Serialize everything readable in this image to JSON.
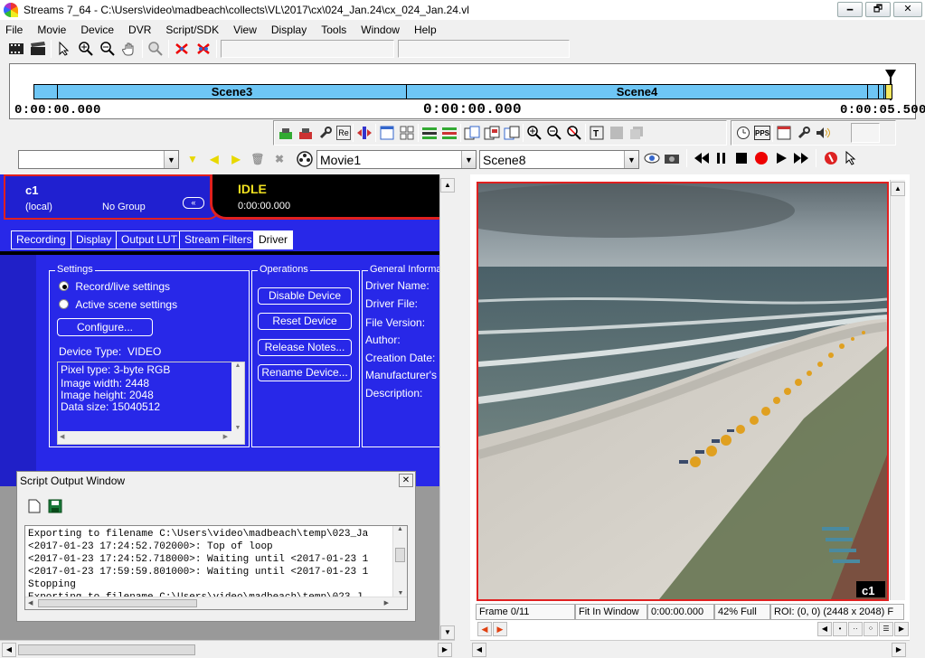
{
  "window": {
    "title": "Streams 7_64 - C:\\Users\\video\\madbeach\\collects\\VL\\2017\\cx\\024_Jan.24\\cx_024_Jan.24.vl",
    "minimize": "🗕",
    "maximize": "🗗",
    "close": "✕"
  },
  "menu": [
    "File",
    "Movie",
    "Device",
    "DVR",
    "Script/SDK",
    "View",
    "Display",
    "Tools",
    "Window",
    "Help"
  ],
  "timeline": {
    "scenes": [
      "Scene3",
      "Scene4"
    ],
    "start_time": "0:00:00.000",
    "current_time": "0:00:00.000",
    "end_time": "0:00:05.500"
  },
  "toolbar2": {
    "re_label": "Re",
    "pps_label": "PPS"
  },
  "selectors": {
    "device_select": "",
    "movie_select": "Movie1",
    "scene_select": "Scene8"
  },
  "device": {
    "name": "c1",
    "location": "(local)",
    "group": "No Group",
    "status": "IDLE",
    "time": "0:00:00.000"
  },
  "tabs": [
    "Recording",
    "Display",
    "Output LUT",
    "Stream Filters",
    "Driver"
  ],
  "settings": {
    "legend": "Settings",
    "radio_record": "Record/live settings",
    "radio_active": "Active scene settings",
    "configure_button": "Configure...",
    "device_type_label": "Device Type:",
    "device_type_value": "VIDEO",
    "info_lines": [
      "Pixel type: 3-byte RGB",
      "Image width: 2448",
      "Image height: 2048",
      "Data size: 15040512"
    ]
  },
  "operations": {
    "legend": "Operations",
    "buttons": [
      "Disable Device",
      "Reset Device",
      "Release Notes...",
      "Rename Device..."
    ]
  },
  "general_info": {
    "legend": "General Informati",
    "labels": [
      "Driver Name:",
      "Driver File:",
      "File Version:",
      "Author:",
      "Creation Date:",
      "Manufacturer's Li",
      "Description:"
    ]
  },
  "script_window": {
    "title": "Script Output Window",
    "close": "✕",
    "lines": [
      "Exporting to filename C:\\Users\\video\\madbeach\\temp\\023_Ja",
      "<2017-01-23 17:24:52.702000>: Top of loop",
      "<2017-01-23 17:24:52.718000>: Waiting until <2017-01-23 1",
      "<2017-01-23 17:59:59.801000>: Waiting until <2017-01-23 1",
      "Stopping",
      "Exporting to filename C:\\Users\\video\\madbeach\\temp\\023_J"
    ]
  },
  "viewer": {
    "overlay_label": "c1",
    "frame": "Frame 0/11",
    "fit": "Fit In Window",
    "time": "0:00:00.000",
    "zoom": "42% Full",
    "roi": "ROI: (0, 0) (2448 x 2048) F"
  },
  "colors": {
    "panel_blue": "#2828e8",
    "accent_red": "#e02020",
    "timeline_blue": "#6ec6f5",
    "status_yellow": "#f0e020"
  }
}
